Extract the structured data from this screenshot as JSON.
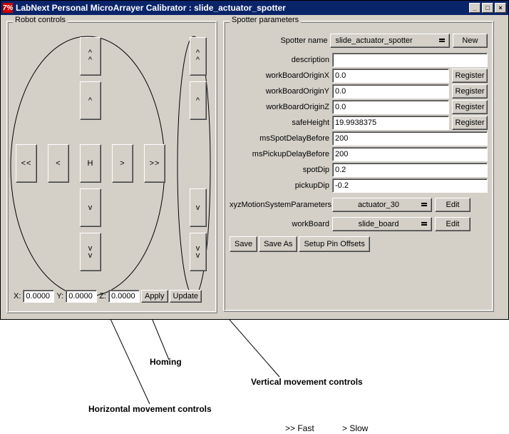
{
  "window": {
    "icon_text": "7%",
    "title": "LabNext Personal MicroArrayer Calibrator : slide_actuator_spotter",
    "min": "_",
    "max": "□",
    "close": "×",
    "minimize_name": "minimize",
    "maximize_name": "maximize",
    "close_name": "close"
  },
  "robot": {
    "legend": "Robot controls",
    "btns": {
      "up_fast": "^\n^",
      "up_slow": "^",
      "left_fast": "<<",
      "left_slow": "<",
      "home": "H",
      "right_slow": ">",
      "right_fast": ">>",
      "down_slow": "v",
      "down_fast": "v\nv",
      "z_up_fast": "^\n^",
      "z_up_slow": "^",
      "z_down_slow": "v",
      "z_down_fast": "v\nv"
    },
    "coord": {
      "xlabel": "X:",
      "xval": "0.0000",
      "ylabel": "Y:",
      "yval": "0.0000",
      "zlabel": "Z:",
      "zval": "0.0000",
      "apply": "Apply",
      "update": "Update"
    }
  },
  "spotter": {
    "legend": "Spotter parameters",
    "name_label": "Spotter name",
    "name_value": "slide_actuator_spotter",
    "new": "New",
    "rows": [
      {
        "label": "description",
        "value": ""
      },
      {
        "label": "workBoardOriginX",
        "value": "0.0",
        "register": true
      },
      {
        "label": "workBoardOriginY",
        "value": "0.0",
        "register": true
      },
      {
        "label": "workBoardOriginZ",
        "value": "0.0",
        "register": true
      },
      {
        "label": "safeHeight",
        "value": "19.9938375",
        "register": true
      },
      {
        "label": "msSpotDelayBefore",
        "value": "200"
      },
      {
        "label": "msPickupDelayBefore",
        "value": "200"
      },
      {
        "label": "spotDip",
        "value": "0.2"
      },
      {
        "label": "pickupDip",
        "value": "-0.2"
      }
    ],
    "register": "Register",
    "xyz_label": "xyzMotionSystemParameters",
    "xyz_value": "actuator_30",
    "workboard_label": "workBoard",
    "workboard_value": "slide_board",
    "edit": "Edit",
    "save": "Save",
    "saveas": "Save As",
    "setup": "Setup Pin Offsets"
  },
  "annotations": {
    "homing": "Homing",
    "vertical": "Vertical movement controls",
    "horizontal": "Horizontal movement controls",
    "fast": ">> Fast",
    "slow": "> Slow"
  }
}
